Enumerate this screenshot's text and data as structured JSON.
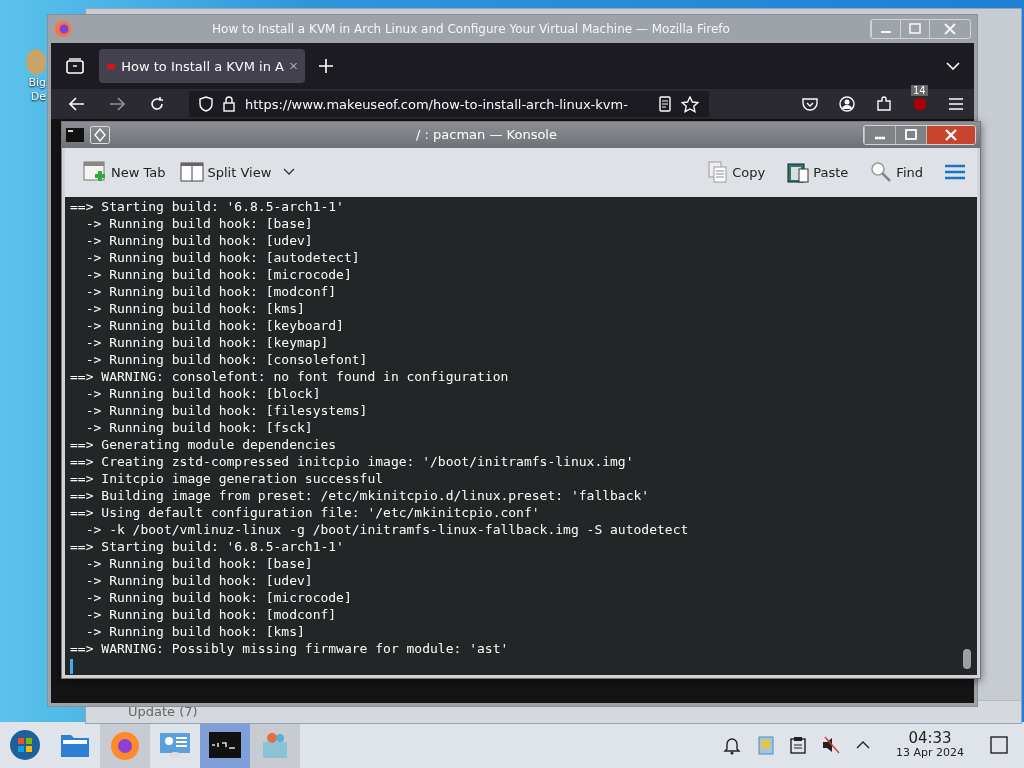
{
  "desktop": {
    "icon_label_lines": [
      "Big",
      "De"
    ]
  },
  "background_window": {
    "title": "Update (7)"
  },
  "firefox": {
    "title": "How to Install a KVM in Arch Linux and Configure Your Virtual Machine — Mozilla Firefo",
    "tabs": [
      {
        "label": "How to Install a KVM in A",
        "selected": true
      }
    ],
    "url": "https://www.makeuseof.com/how-to-install-arch-linux-kvm-",
    "extension_badge": "14"
  },
  "konsole": {
    "title": "/ : pacman — Konsole",
    "toolbar": [
      {
        "label": "New Tab",
        "kind": "new-tab"
      },
      {
        "label": "Split View",
        "kind": "split-view"
      },
      {
        "label": "Copy",
        "kind": "copy"
      },
      {
        "label": "Paste",
        "kind": "paste"
      },
      {
        "label": "Find",
        "kind": "find"
      }
    ],
    "lines": [
      "==> Starting build: '6.8.5-arch1-1'",
      "  -> Running build hook: [base]",
      "  -> Running build hook: [udev]",
      "  -> Running build hook: [autodetect]",
      "  -> Running build hook: [microcode]",
      "  -> Running build hook: [modconf]",
      "  -> Running build hook: [kms]",
      "  -> Running build hook: [keyboard]",
      "  -> Running build hook: [keymap]",
      "  -> Running build hook: [consolefont]",
      "==> WARNING: consolefont: no font found in configuration",
      "  -> Running build hook: [block]",
      "  -> Running build hook: [filesystems]",
      "  -> Running build hook: [fsck]",
      "==> Generating module dependencies",
      "==> Creating zstd-compressed initcpio image: '/boot/initramfs-linux.img'",
      "==> Initcpio image generation successful",
      "==> Building image from preset: /etc/mkinitcpio.d/linux.preset: 'fallback'",
      "==> Using default configuration file: '/etc/mkinitcpio.conf'",
      "  -> -k /boot/vmlinuz-linux -g /boot/initramfs-linux-fallback.img -S autodetect",
      "==> Starting build: '6.8.5-arch1-1'",
      "  -> Running build hook: [base]",
      "  -> Running build hook: [udev]",
      "  -> Running build hook: [microcode]",
      "  -> Running build hook: [modconf]",
      "  -> Running build hook: [kms]",
      "==> WARNING: Possibly missing firmware for module: 'ast'"
    ]
  },
  "taskbar": {
    "apps": [
      {
        "kind": "start",
        "open": false,
        "selected": false
      },
      {
        "kind": "files",
        "open": false,
        "selected": false
      },
      {
        "kind": "browser",
        "open": true,
        "selected": false
      },
      {
        "kind": "settings",
        "open": false,
        "selected": false
      },
      {
        "kind": "terminal",
        "open": true,
        "selected": true
      },
      {
        "kind": "package",
        "open": true,
        "selected": false
      }
    ],
    "clock": {
      "time": "04:33",
      "date": "13 Apr 2024"
    }
  }
}
